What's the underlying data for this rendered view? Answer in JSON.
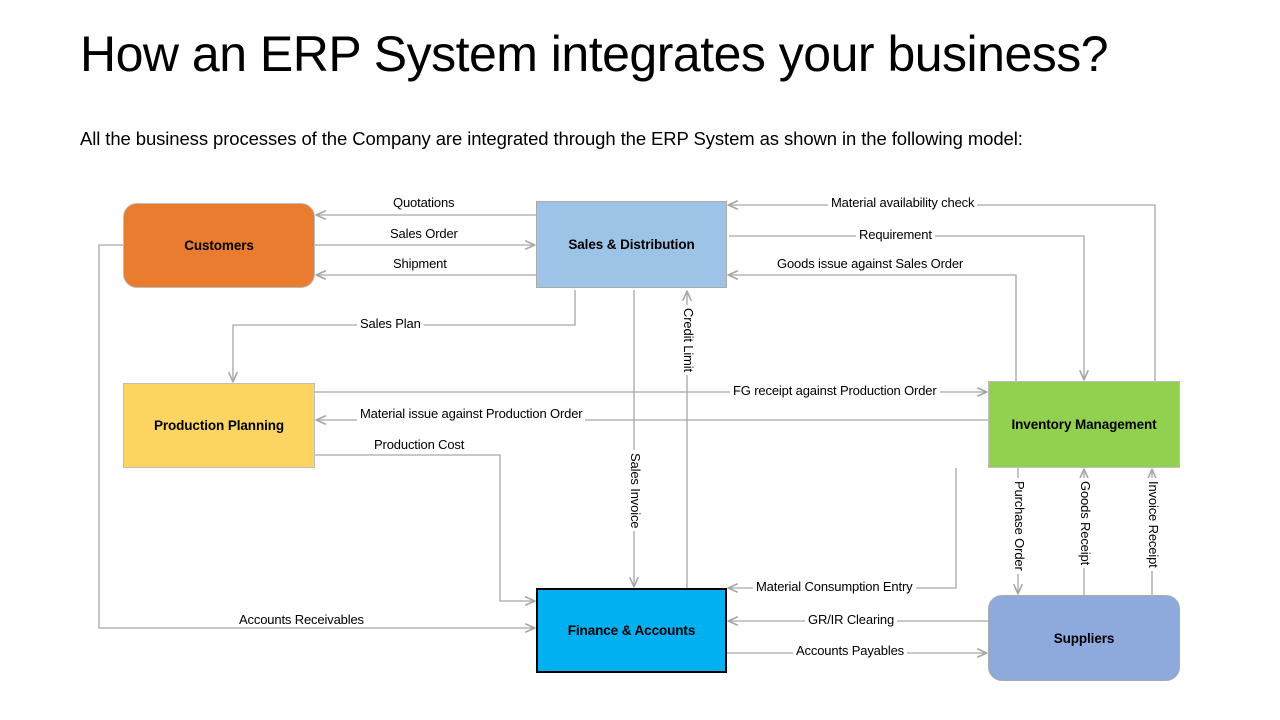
{
  "slide": {
    "title": "How an ERP System integrates your business?",
    "subtitle": "All the business processes of the Company are integrated through the ERP System as shown in the following model:"
  },
  "nodes": [
    {
      "id": "customers",
      "label": "Customers",
      "color": "#E97C2E",
      "shape": "rounded-rect"
    },
    {
      "id": "sales",
      "label": "Sales & Distribution",
      "color": "#9DC3E6",
      "shape": "rect"
    },
    {
      "id": "production",
      "label": "Production Planning",
      "color": "#FCD462",
      "shape": "rect"
    },
    {
      "id": "inventory",
      "label": "Inventory Management",
      "color": "#92D050",
      "shape": "rect"
    },
    {
      "id": "finance",
      "label": "Finance & Accounts",
      "color": "#00B0F0",
      "shape": "rect"
    },
    {
      "id": "suppliers",
      "label": "Suppliers",
      "color": "#8EA9DB",
      "shape": "rounded-rect"
    }
  ],
  "flows": [
    {
      "id": "quotations",
      "label": "Quotations",
      "from": "sales",
      "to": "customers",
      "orientation": "horizontal"
    },
    {
      "id": "sales-order",
      "label": "Sales Order",
      "from": "customers",
      "to": "sales",
      "orientation": "horizontal"
    },
    {
      "id": "shipment",
      "label": "Shipment",
      "from": "sales",
      "to": "customers",
      "orientation": "horizontal"
    },
    {
      "id": "material-avail",
      "label": "Material availability check",
      "from": "inventory",
      "to": "sales",
      "orientation": "horizontal"
    },
    {
      "id": "requirement",
      "label": "Requirement",
      "from": "sales",
      "to": "inventory",
      "orientation": "horizontal"
    },
    {
      "id": "goods-issue",
      "label": "Goods issue against Sales Order",
      "from": "inventory",
      "to": "sales",
      "orientation": "horizontal"
    },
    {
      "id": "sales-plan",
      "label": "Sales Plan",
      "from": "sales",
      "to": "production",
      "orientation": "horizontal"
    },
    {
      "id": "credit-limit",
      "label": "Credit Limit",
      "from": "finance",
      "to": "sales",
      "orientation": "vertical"
    },
    {
      "id": "sales-invoice",
      "label": "Sales Invoice",
      "from": "sales",
      "to": "finance",
      "orientation": "vertical"
    },
    {
      "id": "fg-receipt",
      "label": "FG receipt against Production Order",
      "from": "production",
      "to": "inventory",
      "orientation": "horizontal"
    },
    {
      "id": "material-issue",
      "label": "Material issue against Production Order",
      "from": "inventory",
      "to": "production",
      "orientation": "horizontal"
    },
    {
      "id": "production-cost",
      "label": "Production  Cost",
      "from": "production",
      "to": "finance",
      "orientation": "horizontal"
    },
    {
      "id": "accounts-recv",
      "label": "Accounts Receivables",
      "from": "customers",
      "to": "finance",
      "orientation": "horizontal"
    },
    {
      "id": "mat-consumption",
      "label": "Material Consumption  Entry",
      "from": "inventory",
      "to": "finance",
      "orientation": "horizontal"
    },
    {
      "id": "gr-ir",
      "label": "GR/IR Clearing",
      "from": "suppliers",
      "to": "finance",
      "orientation": "horizontal"
    },
    {
      "id": "accounts-pay",
      "label": "Accounts Payables",
      "from": "finance",
      "to": "suppliers",
      "orientation": "horizontal"
    },
    {
      "id": "purchase-order",
      "label": "Purchase Order",
      "from": "inventory",
      "to": "suppliers",
      "orientation": "vertical"
    },
    {
      "id": "goods-receipt",
      "label": "Goods Receipt",
      "from": "suppliers",
      "to": "inventory",
      "orientation": "vertical"
    },
    {
      "id": "invoice-receipt",
      "label": "Invoice Receipt",
      "from": "suppliers",
      "to": "inventory",
      "orientation": "vertical"
    }
  ],
  "style": {
    "wire_color": "#A6A6A6",
    "background": "#FFFFFF"
  }
}
